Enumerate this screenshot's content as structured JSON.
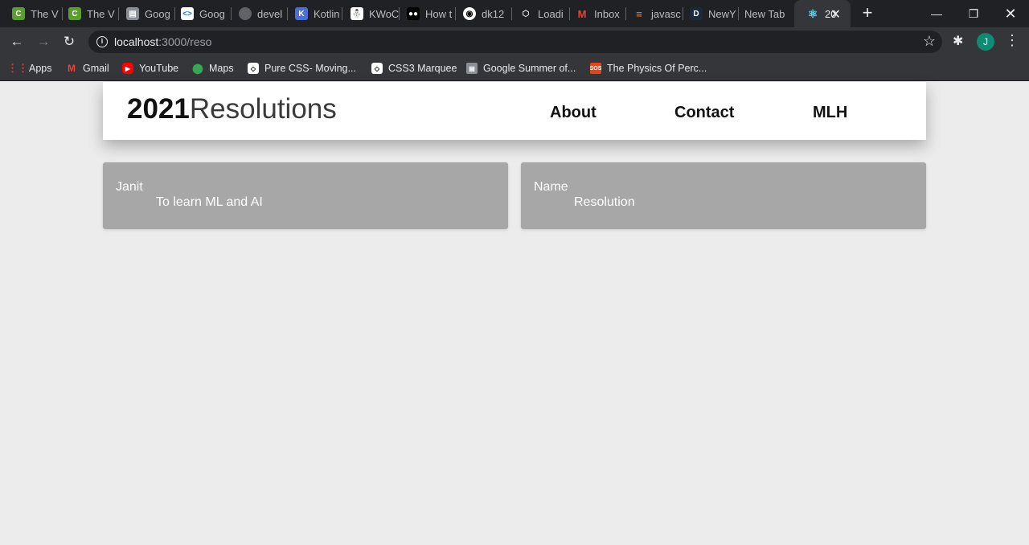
{
  "browser": {
    "tabs": [
      {
        "title": "The V",
        "icon": "codechef-icon",
        "color": "#5b9e2f"
      },
      {
        "title": "The V",
        "icon": "codechef-icon",
        "color": "#5b9e2f"
      },
      {
        "title": "Goog",
        "icon": "google-doc-icon",
        "color": "#8a8f96"
      },
      {
        "title": "Goog",
        "icon": "google-code-icon",
        "color": "#ffffff"
      },
      {
        "title": "devel",
        "icon": "globe-icon",
        "color": "#5f6368"
      },
      {
        "title": "Kotlin",
        "icon": "kotlin-icon",
        "color": "#4b6fd6"
      },
      {
        "title": "KWoC",
        "icon": "kwoc-icon",
        "color": "#ffffff"
      },
      {
        "title": "How t",
        "icon": "medium-icon",
        "color": "#000000"
      },
      {
        "title": "dk12",
        "icon": "github-icon",
        "color": "#ffffff"
      },
      {
        "title": "Loadi",
        "icon": "codesandbox-icon",
        "color": "#ffffff"
      },
      {
        "title": "Inbox",
        "icon": "gmail-icon",
        "color": "#ea4335"
      },
      {
        "title": "javasc",
        "icon": "stackoverflow-icon",
        "color": "#f48024"
      },
      {
        "title": "NewY",
        "icon": "dev-icon",
        "color": "#1e2a3a"
      },
      {
        "title": "New Tab",
        "icon": "",
        "color": ""
      },
      {
        "title": "20",
        "icon": "react-icon",
        "color": "#61dafb"
      }
    ],
    "address": {
      "host": "localhost",
      "rest": ":3000/reso"
    },
    "profile_initial": "J",
    "bookmarks": [
      {
        "label": "Apps",
        "icon": "apps-grid-icon",
        "color": "#e53935"
      },
      {
        "label": "Gmail",
        "icon": "gmail-icon",
        "color": "#ea4335"
      },
      {
        "label": "YouTube",
        "icon": "youtube-icon",
        "color": "#ff0000"
      },
      {
        "label": "Maps",
        "icon": "maps-pin-icon",
        "color": "#34a853"
      },
      {
        "label": "Pure CSS- Moving...",
        "icon": "codepen-icon",
        "color": "#ffffff"
      },
      {
        "label": "CSS3 Marquee",
        "icon": "codepen-icon",
        "color": "#ffffff"
      },
      {
        "label": "Google Summer of...",
        "icon": "doc-icon",
        "color": "#8a8f96"
      },
      {
        "label": "The Physics Of Perc...",
        "icon": "sos-icon",
        "color": "#e8431b"
      }
    ]
  },
  "page": {
    "brand_year": "2021",
    "brand_word": "Resolutions",
    "nav": [
      "About",
      "Contact",
      "MLH"
    ],
    "cards": [
      {
        "name": "Janit",
        "resolution": "To learn ML and AI"
      },
      {
        "name": "Name",
        "resolution": "Resolution"
      }
    ]
  }
}
